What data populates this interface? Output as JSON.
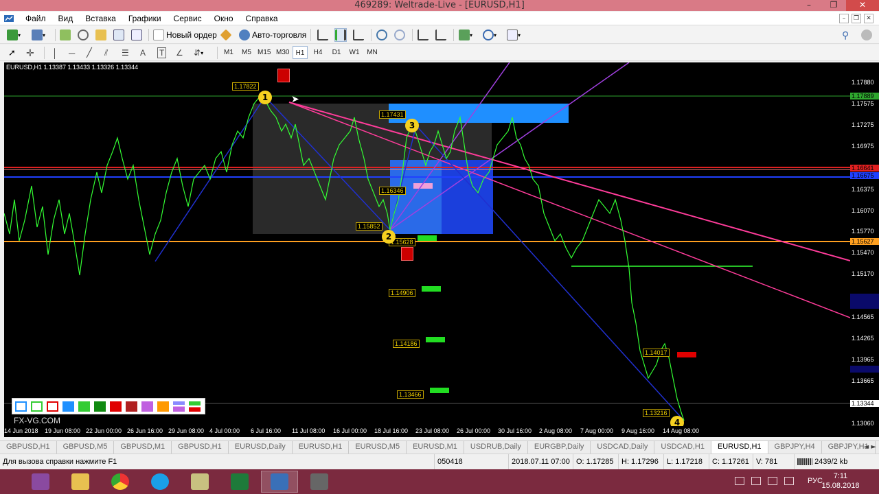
{
  "window": {
    "title": "469289: Weltrade-Live - [EURUSD,H1]",
    "controls": [
      "–",
      "❐",
      "✕"
    ]
  },
  "menu": {
    "items": [
      "Файл",
      "Вид",
      "Вставка",
      "Графики",
      "Сервис",
      "Окно",
      "Справка"
    ]
  },
  "toolbar": {
    "new_order": "Новый ордер",
    "auto_trading": "Авто-торговля",
    "timeframes": [
      "M1",
      "M5",
      "M15",
      "M30",
      "H1",
      "H4",
      "D1",
      "W1",
      "MN"
    ],
    "active_timeframe": "H1"
  },
  "chart": {
    "symbol_info": "EURUSD,H1  1.13387 1.13433 1.13326 1.13344",
    "watermark": "FX-VG.COM",
    "level_labels": [
      "1.17822",
      "1.17431",
      "1.16346",
      "1.15852",
      "1.15628",
      "1.14906",
      "1.14186",
      "1.13466",
      "1.14017",
      "1.13216"
    ],
    "price_ticks": [
      "1.17880",
      "1.17575",
      "1.17275",
      "1.16975",
      "1.16675",
      "1.16375",
      "1.16070",
      "1.15770",
      "1.15470",
      "1.15170",
      "1.14565",
      "1.14265",
      "1.13965",
      "1.13665",
      "1.13060"
    ],
    "highlighted_prices": {
      "green": "1.17889",
      "red": "1.16641",
      "orange": "1.15627",
      "current": "1.13344"
    },
    "time_ticks": [
      "14 Jun 2018",
      "19 Jun 08:00",
      "22 Jun 00:00",
      "26 Jun 16:00",
      "29 Jun 08:00",
      "4 Jul 00:00",
      "6 Jul 16:00",
      "11 Jul 08:00",
      "16 Jul 00:00",
      "18 Jul 16:00",
      "23 Jul 08:00",
      "26 Jul 00:00",
      "30 Jul 16:00",
      "2 Aug 08:00",
      "7 Aug 00:00",
      "9 Aug 16:00",
      "14 Aug 08:00"
    ],
    "markers": [
      "1",
      "2",
      "3",
      "4"
    ],
    "colors": {
      "background": "#000000",
      "price_line": "#33ff33",
      "trend_magenta": "#ff3c9a",
      "trend_purple": "#a040e0",
      "zone_blue": "#1f8fff",
      "level_orange": "#ffa020",
      "level_red": "#e02020"
    }
  },
  "palette": {
    "colors": [
      "#ffffff",
      "#ffffff",
      "#ffffff",
      "#1e90ff",
      "#33cc33",
      "#108a10",
      "#e00000",
      "#b02020",
      "#c060e0",
      "#ff9900",
      "#8a8aff",
      "#33cc33"
    ]
  },
  "tabs": {
    "items": [
      "GBPUSD,H1",
      "GBPUSD,M5",
      "GBPUSD,M1",
      "GBPUSD,H1",
      "EURUSD,Daily",
      "EURUSD,H1",
      "EURUSD,M5",
      "EURUSD,M1",
      "USDRUB,Daily",
      "EURGBP,Daily",
      "USDCAD,Daily",
      "USDCAD,H1",
      "EURUSD,H1",
      "GBPJPY,H4",
      "GBPJPY,H1"
    ],
    "active_index": 12,
    "nav": "◄ ►"
  },
  "status": {
    "help": "Для вызова справки нажмите F1",
    "profile": "050418",
    "datetime": "2018.07.11 07:00",
    "open": "O: 1.17285",
    "high": "H: 1.17296",
    "low": "L: 1.17218",
    "close": "C: 1.17261",
    "volume": "V: 781",
    "traffic": "2439/2 kb"
  },
  "taskbar": {
    "apps": [
      "winrar-icon",
      "folder-icon",
      "chrome-icon",
      "skype-icon",
      "notes-icon",
      "excel-icon",
      "metatrader-icon",
      "app-icon"
    ],
    "lang": "РУС",
    "time": "7:11",
    "date": "15.08.2018"
  }
}
